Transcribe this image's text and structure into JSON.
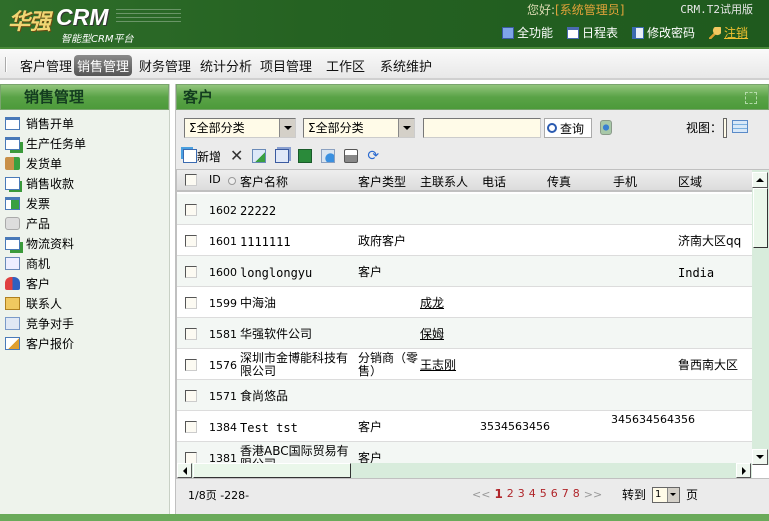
{
  "header": {
    "brand_cn": "华强",
    "brand_en": "CRM",
    "tagline": "智能型CRM平台",
    "greeting": "您好:",
    "user": "[系统管理员]",
    "version": "CRM.T2试用版",
    "links": [
      {
        "label": "全功能",
        "icon": "full-function-icon"
      },
      {
        "label": "日程表",
        "icon": "calendar-icon"
      },
      {
        "label": "修改密码",
        "icon": "password-icon"
      },
      {
        "label": "注销",
        "icon": "key-icon"
      }
    ]
  },
  "nav": {
    "items": [
      "客户管理",
      "销售管理",
      "财务管理",
      "统计分析",
      "项目管理",
      "工作区",
      "系统维护"
    ],
    "active": "销售管理"
  },
  "sidebar": {
    "title": "销售管理",
    "items": [
      {
        "label": "销售开单",
        "icon": "sales-order-icon"
      },
      {
        "label": "生产任务单",
        "icon": "production-task-icon"
      },
      {
        "label": "发货单",
        "icon": "delivery-icon"
      },
      {
        "label": "销售收款",
        "icon": "receipt-icon"
      },
      {
        "label": "发票",
        "icon": "invoice-icon"
      },
      {
        "label": "产品",
        "icon": "product-icon"
      },
      {
        "label": "物流资料",
        "icon": "logistics-icon"
      },
      {
        "label": "商机",
        "icon": "opportunity-icon"
      },
      {
        "label": "客户",
        "icon": "customer-icon"
      },
      {
        "label": "联系人",
        "icon": "contact-icon"
      },
      {
        "label": "竞争对手",
        "icon": "competitor-icon"
      },
      {
        "label": "客户报价",
        "icon": "quote-icon"
      }
    ]
  },
  "main": {
    "title": "客户",
    "filter": {
      "category1": "Σ全部分类",
      "category2": "Σ全部分类",
      "search_value": "",
      "query_label": "查询",
      "view_label": "视图："
    },
    "toolbar": {
      "new_label": "新增"
    },
    "columns": [
      "ID",
      "客户名称",
      "客户类型",
      "主联系人",
      "电话",
      "传真",
      "手机",
      "区域"
    ],
    "rows": [
      {
        "id": "1602",
        "name": "22222",
        "type": "",
        "contact": "",
        "phone": "",
        "fax": "",
        "mobile": "",
        "region": ""
      },
      {
        "id": "1601",
        "name": "1111111",
        "type": "政府客户",
        "contact": "",
        "phone": "",
        "fax": "",
        "mobile": "",
        "region": "济南大区qq"
      },
      {
        "id": "1600",
        "name": "longlongyu",
        "type": "客户",
        "contact": "",
        "phone": "",
        "fax": "",
        "mobile": "",
        "region": "India"
      },
      {
        "id": "1599",
        "name": "中海油",
        "type": "",
        "contact": "成龙",
        "phone": "",
        "fax": "",
        "mobile": "",
        "region": ""
      },
      {
        "id": "1581",
        "name": "华强软件公司",
        "type": "",
        "contact": "保姆",
        "phone": "",
        "fax": "",
        "mobile": "",
        "region": ""
      },
      {
        "id": "1576",
        "name": "深圳市金博能科技有限公司",
        "type": "分销商（零售）",
        "contact": "王志刚",
        "phone": "",
        "fax": "",
        "mobile": "",
        "region": "鲁西南大区"
      },
      {
        "id": "1571",
        "name": "食尚悠品",
        "type": "",
        "contact": "",
        "phone": "",
        "fax": "",
        "mobile": "",
        "region": ""
      },
      {
        "id": "1384",
        "name": "Test tst",
        "type": "客户",
        "contact": "",
        "phone": "3534563456",
        "fax": "",
        "mobile": "345634564356",
        "region": ""
      },
      {
        "id": "1381",
        "name": "香港ABC国际贸易有限公司",
        "type": "客户",
        "contact": "",
        "phone": "",
        "fax": "",
        "mobile": "",
        "region": ""
      }
    ],
    "footer": {
      "page_info": "1/8页 -228-",
      "prev": "<<",
      "next": ">>",
      "pages": [
        "1",
        "2",
        "3",
        "4",
        "5",
        "6",
        "7",
        "8"
      ],
      "current_page": "1",
      "goto_label": "转到",
      "goto_value": "1",
      "page_suffix": "页"
    }
  }
}
